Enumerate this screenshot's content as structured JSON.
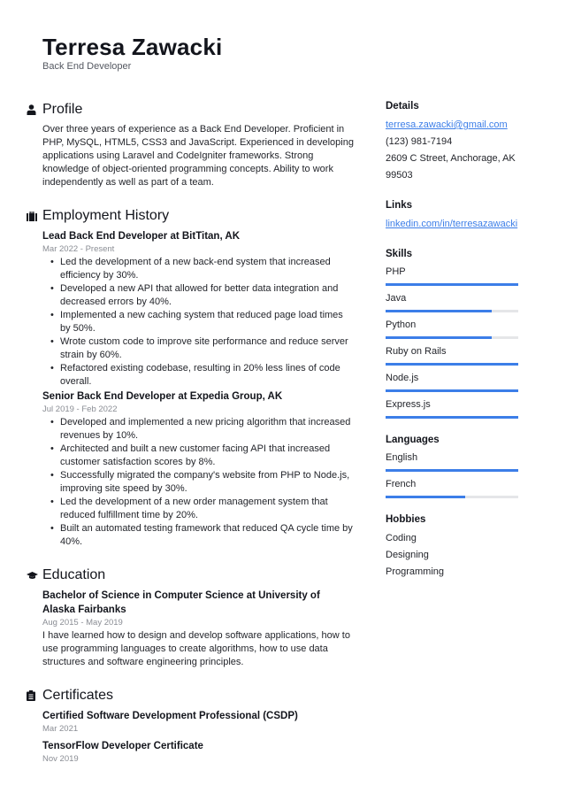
{
  "header": {
    "name": "Terresa Zawacki",
    "title": "Back End Developer"
  },
  "profile": {
    "heading": "Profile",
    "icon": "person-icon",
    "text": "Over three years of experience as a Back End Developer. Proficient in PHP, MySQL, HTML5, CSS3 and JavaScript. Experienced in developing applications using Laravel and CodeIgniter frameworks. Strong knowledge of object-oriented programming concepts. Ability to work independently as well as part of a team."
  },
  "employment": {
    "heading": "Employment History",
    "icon": "briefcase-icon",
    "jobs": [
      {
        "title": "Lead Back End Developer at BitTitan, AK",
        "date": "Mar 2022 - Present",
        "bullets": [
          "Led the development of a new back-end system that increased efficiency by 30%.",
          "Developed a new API that allowed for better data integration and decreased errors by 40%.",
          "Implemented a new caching system that reduced page load times by 50%.",
          "Wrote custom code to improve site performance and reduce server strain by 60%.",
          "Refactored existing codebase, resulting in 20% less lines of code overall."
        ]
      },
      {
        "title": "Senior Back End Developer at Expedia Group, AK",
        "date": "Jul 2019 - Feb 2022",
        "bullets": [
          "Developed and implemented a new pricing algorithm that increased revenues by 10%.",
          "Architected and built a new customer facing API that increased customer satisfaction scores by 8%.",
          "Successfully migrated the company's website from PHP to Node.js, improving site speed by 30%.",
          "Led the development of a new order management system that reduced fulfillment time by 20%.",
          "Built an automated testing framework that reduced QA cycle time by 40%."
        ]
      }
    ]
  },
  "education": {
    "heading": "Education",
    "icon": "graduation-cap-icon",
    "items": [
      {
        "title": "Bachelor of Science in Computer Science at University of Alaska Fairbanks",
        "date": "Aug 2015 - May 2019",
        "text": "I have learned how to design and develop software applications, how to use programming languages to create algorithms, how to use data structures and software engineering principles."
      }
    ]
  },
  "certificates": {
    "heading": "Certificates",
    "icon": "clipboard-icon",
    "items": [
      {
        "title": "Certified Software Development Professional (CSDP)",
        "date": "Mar 2021"
      },
      {
        "title": "TensorFlow Developer Certificate",
        "date": "Nov 2019"
      }
    ]
  },
  "details": {
    "heading": "Details",
    "email": "terresa.zawacki@gmail.com",
    "phone": "(123) 981-7194",
    "address": "2609 C Street, Anchorage, AK 99503"
  },
  "links": {
    "heading": "Links",
    "items": [
      "linkedin.com/in/terresazawacki"
    ]
  },
  "skills": {
    "heading": "Skills",
    "items": [
      {
        "name": "PHP",
        "level": 100
      },
      {
        "name": "Java",
        "level": 80
      },
      {
        "name": "Python",
        "level": 80
      },
      {
        "name": "Ruby on Rails",
        "level": 100
      },
      {
        "name": "Node.js",
        "level": 100
      },
      {
        "name": "Express.js",
        "level": 100
      }
    ]
  },
  "languages": {
    "heading": "Languages",
    "items": [
      {
        "name": "English",
        "level": 100
      },
      {
        "name": "French",
        "level": 60
      }
    ]
  },
  "hobbies": {
    "heading": "Hobbies",
    "items": [
      "Coding",
      "Designing",
      "Programming"
    ]
  },
  "colors": {
    "accent": "#3c7ee8",
    "track": "#e5e6e8",
    "text": "#13151c",
    "muted": "#8a8d94"
  }
}
